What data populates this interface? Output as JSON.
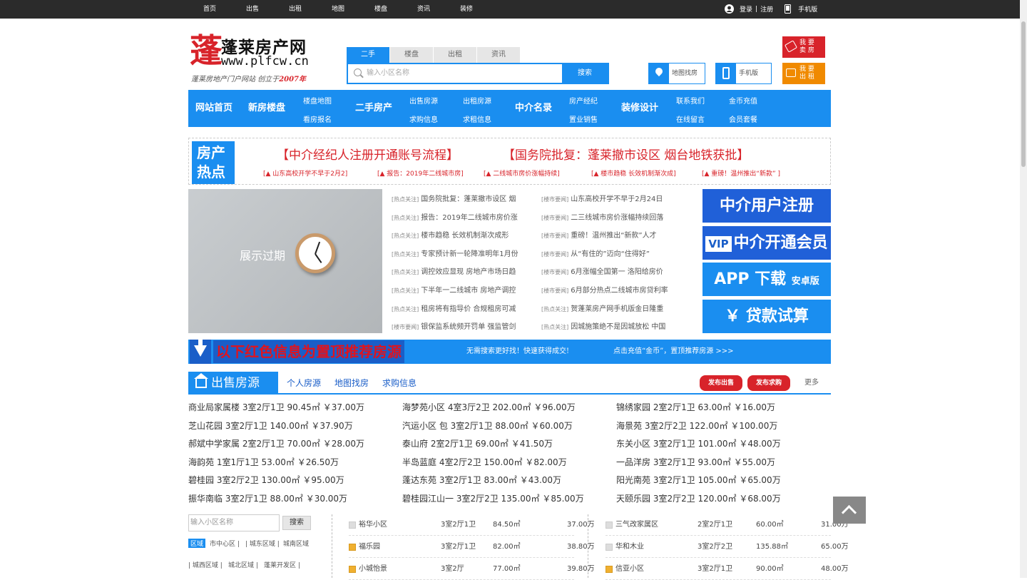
{
  "topbar": {
    "links": [
      "首页",
      "出售",
      "出租",
      "地图",
      "楼盘",
      "资讯",
      "装修"
    ],
    "login": "登录",
    "sep": "|",
    "register": "注册",
    "mobile": "手机版"
  },
  "logo": {
    "mark": "蓬",
    "name": "蓬莱房产网",
    "url": "www.plfcw.cn",
    "slogan_a": "蓬莱房地产门户网站  创立于",
    "slogan_b": "2007年"
  },
  "search": {
    "tabs": [
      "二手",
      "楼盘",
      "出租",
      "资讯"
    ],
    "placeholder": "输入小区名称",
    "button": "搜索"
  },
  "quick": {
    "map": "地图找房",
    "mobile": "手机版",
    "sell": "我 要\n卖 房",
    "rent": "我 要\n出 租"
  },
  "nav": {
    "home": "网站首页",
    "newhouse": "新房楼盘",
    "map": "楼盘地图",
    "signup": "看房报名",
    "second": "二手房产",
    "sell_src": "出售房源",
    "buy_info": "求购信息",
    "rent_src": "出租房源",
    "rentw_info": "求租信息",
    "agents": "中介名录",
    "broker": "房产经纪",
    "consultant": "置业销售",
    "decor": "装修设计",
    "contact": "联系我们",
    "message": "在线留言",
    "coins": "金币充值",
    "pkg": "会员套餐"
  },
  "hot": {
    "box": "房产\n热点",
    "h1a": "【中介经纪人注册开通账号流程】",
    "h1b": "【国务院批复：蓬莱撤市设区 烟台地铁获批】",
    "h2": [
      "[▲ 山东高校开学不早于2月2]",
      "[▲ 报告：2019年二线城市房]",
      "[▲ 二线城市房价涨幅持续]",
      "[▲ 楼市趋稳 长效机制渐次成]",
      "[▲ 重磅！温州推出“新款” ]"
    ]
  },
  "banner": {
    "text": "展示过期"
  },
  "news_left": [
    {
      "tag": "[热点关注]",
      "text": "国务院批复：蓬莱撤市设区 烟"
    },
    {
      "tag": "[热点关注]",
      "text": "报告：2019年二线城市房价涨"
    },
    {
      "tag": "[热点关注]",
      "text": "楼市趋稳 长效机制渐次成形"
    },
    {
      "tag": "[热点关注]",
      "text": "专家预计新一轮降准明年1月份"
    },
    {
      "tag": "[热点关注]",
      "text": "调控效应显现 房地产市场日趋"
    },
    {
      "tag": "[热点关注]",
      "text": "下半年一二线城市 房地产调控"
    },
    {
      "tag": "[热点关注]",
      "text": "租房将有指导价 合规租房可减"
    },
    {
      "tag": "[楼市要闻]",
      "text": "银保监系统频开罚单 强监管剑"
    }
  ],
  "news_right": [
    {
      "tag": "[楼市要闻]",
      "text": "山东高校开学不早于2月24日"
    },
    {
      "tag": "[楼市要闻]",
      "text": "二三线城市房价涨幅持续回落"
    },
    {
      "tag": "[楼市要闻]",
      "text": "重磅！温州推出“新款”人才"
    },
    {
      "tag": "[楼市要闻]",
      "text": "从“有住的”迈向“住得好”"
    },
    {
      "tag": "[楼市要闻]",
      "text": "6月涨幅全国第一 洛阳给房价"
    },
    {
      "tag": "[楼市要闻]",
      "text": "6月部分热点二线城市房贷利率"
    },
    {
      "tag": "[热点关注]",
      "text": "贺蓬莱房产网手机版金日隆重"
    },
    {
      "tag": "[热点关注]",
      "text": "因城施策绝不是因城放松 中国"
    }
  ],
  "side": {
    "reg": "中介用户注册",
    "vip_badge": "VIP",
    "vip": "中介开通会员",
    "app": "APP 下载",
    "app_sub": "安卓版",
    "loan": "￥ 贷款试算"
  },
  "redbar": {
    "big": "以下红色信息为置顶推荐房源",
    "s1": "无需搜索更好找！快速获得成交!",
    "s2": "点击充值“金币”，置顶推荐房源 >>>"
  },
  "section": {
    "title": "出售房源",
    "links": [
      "个人房源",
      "地图找房",
      "求购信息"
    ],
    "post_sell": "发布出售",
    "post_buy": "发布求购",
    "more": "更多"
  },
  "listings": [
    [
      "商业局家属楼 3室2厅1卫 90.45㎡ ￥37.00万",
      "海梦苑小区 4室3厅2卫 202.00㎡ ￥96.00万",
      "锦绣家园 2室2厅1卫 63.00㎡ ￥16.00万"
    ],
    [
      "芝山花园 3室2厅1卫 140.00㎡ ￥37.90万",
      "汽运小区 包 3室2厅1卫 88.00㎡ ￥60.00万",
      "海景苑 3室2厅2卫 122.00㎡ ￥100.00万"
    ],
    [
      "郝斌中学家属 2室2厅1卫 70.00㎡ ￥28.00万",
      "泰山府 2室2厅1卫 69.00㎡ ￥41.50万",
      "东关小区 3室2厅1卫 101.00㎡ ￥48.00万"
    ],
    [
      "海韵苑 1室1厅1卫 53.00㎡ ￥26.50万",
      "半岛蓝庭 4室2厅2卫 150.00㎡ ￥82.00万",
      "一品洋房 3室2厅1卫 93.00㎡ ￥55.00万"
    ],
    [
      "碧桂园 3室2厅2卫 130.00㎡ ￥95.00万",
      "蓬达东苑 3室2厅1卫 83.00㎡ ￥43.00万",
      "阳光南苑 3室2厅1卫 105.00㎡ ￥65.00万"
    ],
    [
      "振华南临 3室2厅1卫 88.00㎡ ￥30.00万",
      "碧桂园江山一 3室2厅2卫 135.00㎡ ￥85.00万",
      "天颐乐园 3室2厅2卫 120.00㎡ ￥68.00万"
    ]
  ],
  "filter": {
    "placeholder": "输入小区名称",
    "button": "搜索",
    "area_label": "区域",
    "areas1": [
      "市中心区",
      "城东区域",
      "城南区域"
    ],
    "areas2": [
      "城西区域",
      "城北区域",
      "蓬莱开发区"
    ]
  },
  "table_mid": [
    {
      "name": "裕华小区",
      "type": "3室2厅1卫",
      "area": "84.50㎡",
      "price": "37.00万",
      "icon": "grey"
    },
    {
      "name": "福乐园",
      "type": "3室2厅1卫",
      "area": "82.00㎡",
      "price": "38.80万",
      "icon": "yellow"
    },
    {
      "name": "小城怡景",
      "type": "3室2厅",
      "area": "77.00㎡",
      "price": "39.80万",
      "icon": "yellow"
    }
  ],
  "table_right": [
    {
      "name": "三气改家属区",
      "type": "2室2厅1卫",
      "area": "60.00㎡",
      "price": "31.00万",
      "icon": "grey"
    },
    {
      "name": "华和木业",
      "type": "3室2厅2卫",
      "area": "135.88㎡",
      "price": "65.00万",
      "icon": "grey"
    },
    {
      "name": "信亚小区",
      "type": "3室2厅1卫",
      "area": "90.00㎡",
      "price": "48.00万",
      "icon": "yellow"
    }
  ],
  "colors": {
    "primary": "#1a8ef0",
    "dark": "#1a5ec8",
    "red": "#d8232a",
    "orange": "#f08a00"
  }
}
